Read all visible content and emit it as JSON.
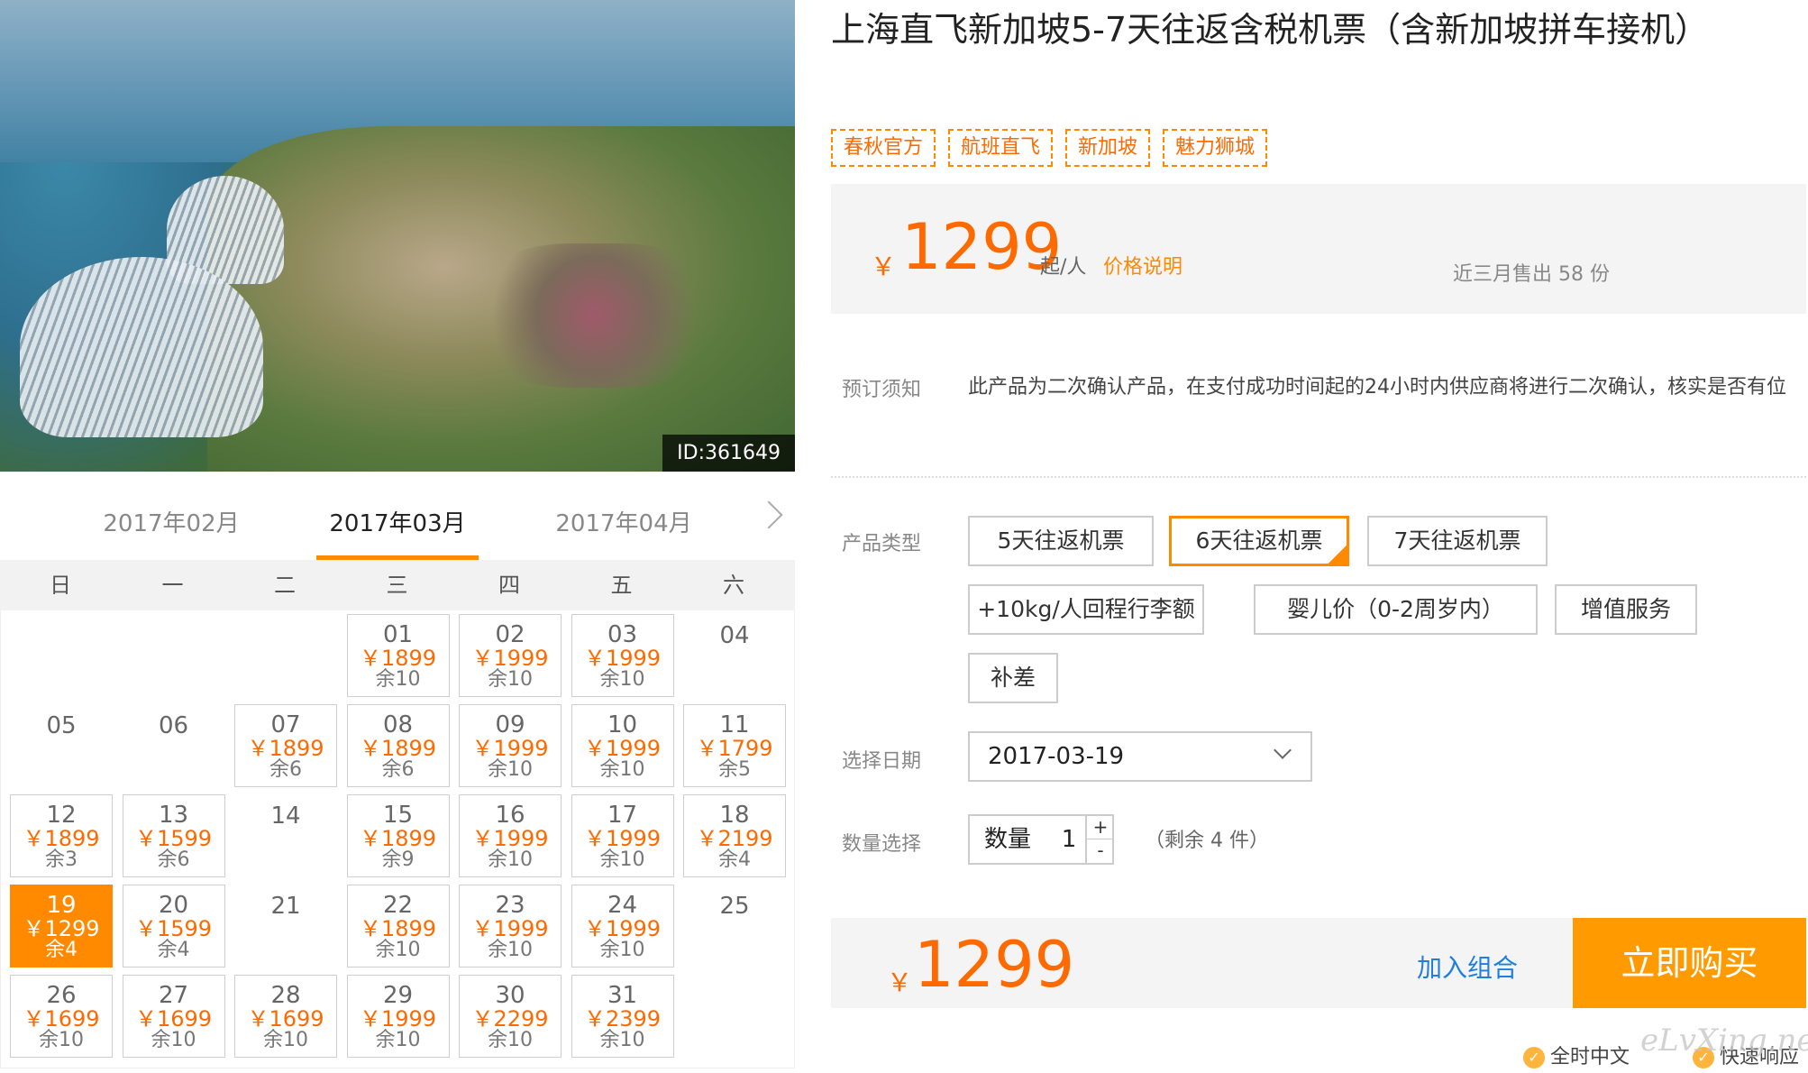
{
  "photo": {
    "id_label": "ID:361649"
  },
  "calendar": {
    "months": [
      "2017年02月",
      "2017年03月",
      "2017年04月"
    ],
    "active_month_index": 1,
    "weekdays": [
      "日",
      "一",
      "二",
      "三",
      "四",
      "五",
      "六"
    ],
    "days": [
      {
        "day": "01",
        "price": "￥1899",
        "stock": "余10",
        "col": 3,
        "row": 0
      },
      {
        "day": "02",
        "price": "￥1999",
        "stock": "余10",
        "col": 4,
        "row": 0
      },
      {
        "day": "03",
        "price": "￥1999",
        "stock": "余10",
        "col": 5,
        "row": 0
      },
      {
        "day": "04",
        "price": "",
        "stock": "",
        "col": 6,
        "row": 0
      },
      {
        "day": "05",
        "price": "",
        "stock": "",
        "col": 0,
        "row": 1
      },
      {
        "day": "06",
        "price": "",
        "stock": "",
        "col": 1,
        "row": 1
      },
      {
        "day": "07",
        "price": "￥1899",
        "stock": "余6",
        "col": 2,
        "row": 1
      },
      {
        "day": "08",
        "price": "￥1899",
        "stock": "余6",
        "col": 3,
        "row": 1
      },
      {
        "day": "09",
        "price": "￥1999",
        "stock": "余10",
        "col": 4,
        "row": 1
      },
      {
        "day": "10",
        "price": "￥1999",
        "stock": "余10",
        "col": 5,
        "row": 1
      },
      {
        "day": "11",
        "price": "￥1799",
        "stock": "余5",
        "col": 6,
        "row": 1
      },
      {
        "day": "12",
        "price": "￥1899",
        "stock": "余3",
        "col": 0,
        "row": 2
      },
      {
        "day": "13",
        "price": "￥1599",
        "stock": "余6",
        "col": 1,
        "row": 2
      },
      {
        "day": "14",
        "price": "",
        "stock": "",
        "col": 2,
        "row": 2
      },
      {
        "day": "15",
        "price": "￥1899",
        "stock": "余9",
        "col": 3,
        "row": 2
      },
      {
        "day": "16",
        "price": "￥1999",
        "stock": "余10",
        "col": 4,
        "row": 2
      },
      {
        "day": "17",
        "price": "￥1999",
        "stock": "余10",
        "col": 5,
        "row": 2
      },
      {
        "day": "18",
        "price": "￥2199",
        "stock": "余4",
        "col": 6,
        "row": 2
      },
      {
        "day": "19",
        "price": "￥1299",
        "stock": "余4",
        "col": 0,
        "row": 3,
        "selected": true
      },
      {
        "day": "20",
        "price": "￥1599",
        "stock": "余4",
        "col": 1,
        "row": 3
      },
      {
        "day": "21",
        "price": "",
        "stock": "",
        "col": 2,
        "row": 3
      },
      {
        "day": "22",
        "price": "￥1899",
        "stock": "余10",
        "col": 3,
        "row": 3
      },
      {
        "day": "23",
        "price": "￥1999",
        "stock": "余10",
        "col": 4,
        "row": 3
      },
      {
        "day": "24",
        "price": "￥1999",
        "stock": "余10",
        "col": 5,
        "row": 3
      },
      {
        "day": "25",
        "price": "",
        "stock": "",
        "col": 6,
        "row": 3
      },
      {
        "day": "26",
        "price": "￥1699",
        "stock": "余10",
        "col": 0,
        "row": 4
      },
      {
        "day": "27",
        "price": "￥1699",
        "stock": "余10",
        "col": 1,
        "row": 4
      },
      {
        "day": "28",
        "price": "￥1699",
        "stock": "余10",
        "col": 2,
        "row": 4
      },
      {
        "day": "29",
        "price": "￥1999",
        "stock": "余10",
        "col": 3,
        "row": 4
      },
      {
        "day": "30",
        "price": "￥2299",
        "stock": "余10",
        "col": 4,
        "row": 4
      },
      {
        "day": "31",
        "price": "￥2399",
        "stock": "余10",
        "col": 5,
        "row": 4
      }
    ]
  },
  "product": {
    "title": "上海直飞新加坡5-7天往返含税机票（含新加坡拼车接机）",
    "tags": [
      "春秋官方",
      "航班直飞",
      "新加坡",
      "魅力狮城"
    ]
  },
  "price_box": {
    "currency": "￥",
    "price": "1299",
    "per_person": "起/人",
    "explain_link": "价格说明",
    "sold_text": "近三月售出 58 份"
  },
  "booking": {
    "notice_label": "预订须知",
    "notice_text": "此产品为二次确认产品，在支付成功时间起的24小时内供应商将进行二次确认，核实是否有位",
    "type_label": "产品类型",
    "types": [
      {
        "label": "5天往返机票",
        "selected": false
      },
      {
        "label": "6天往返机票",
        "selected": true
      },
      {
        "label": "7天往返机票",
        "selected": false
      },
      {
        "label": "+10kg/人回程行李额",
        "selected": false
      },
      {
        "label": "婴儿价（0-2周岁内）",
        "selected": false
      },
      {
        "label": "增值服务",
        "selected": false
      },
      {
        "label": "补差",
        "selected": false
      }
    ],
    "date_label": "选择日期",
    "date_value": "2017-03-19",
    "qty_label": "数量选择",
    "qty_inner_label": "数量",
    "qty_value": "1",
    "qty_plus": "+",
    "qty_minus": "-",
    "remain_text": "（剩余 4 件）"
  },
  "buy_bar": {
    "currency": "￥",
    "price": "1299",
    "combo_link": "加入组合",
    "buy_button": "立即购买"
  },
  "assurances": [
    "全时中文",
    "快速响应"
  ],
  "watermark": "eLvXing.net",
  "colors": {
    "accent": "#ff8a00",
    "price": "#ff6a00",
    "link": "#1f7fe0"
  }
}
